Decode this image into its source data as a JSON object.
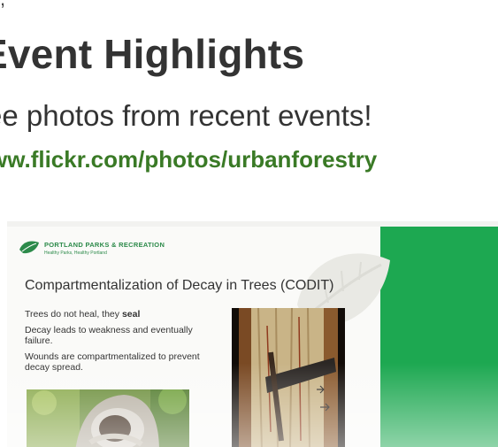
{
  "header": {
    "title": "Event Highlights",
    "subtitle": "ee photos from recent events!",
    "link": "ww.flickr.com/photos/urbanforestry"
  },
  "slide": {
    "logo": {
      "title": "PORTLAND PARKS & RECREATION",
      "subtitle": "Healthy Parks, Healthy Portland"
    },
    "heading_bold": "Compartmentalization of Decay in Trees",
    "heading_normal": " (CODIT)",
    "bullets": {
      "b1_prefix": "Trees do not heal, they ",
      "b1_bold": "seal",
      "b2": "Decay leads to weakness and eventually failure.",
      "b3": "Wounds are compartmentalized to prevent decay spread."
    }
  },
  "colors": {
    "link_green": "#3a7a26",
    "panel_green": "#1da851",
    "logo_green": "#2c8a4a"
  }
}
